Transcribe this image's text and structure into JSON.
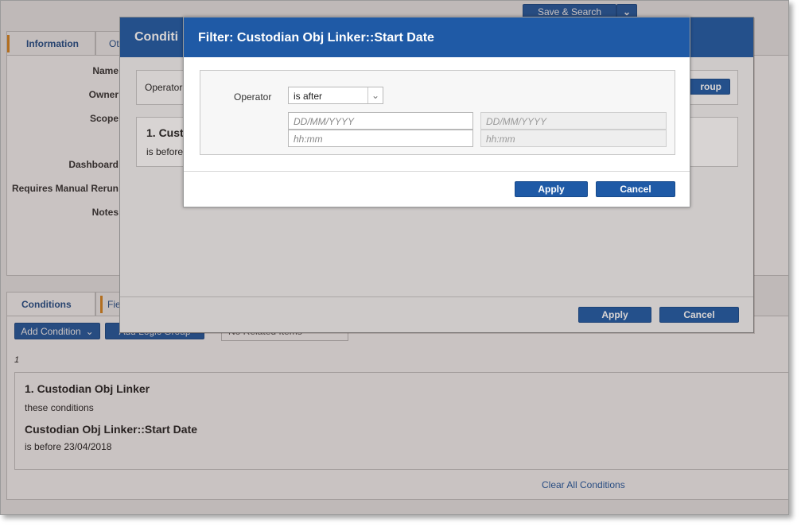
{
  "top": {
    "save_search": "Save & Search"
  },
  "tabs": {
    "information": "Information",
    "other_partial": "Ot"
  },
  "fields": {
    "name": "Name",
    "owner": "Owner",
    "scope": "Scope",
    "dashboard": "Dashboard",
    "requires_manual_rerun": "Requires Manual Rerun",
    "notes": "Notes"
  },
  "bottom_tabs": {
    "conditions": "Conditions",
    "fields_partial": "Fie"
  },
  "toolbar": {
    "add_condition": "Add Condition",
    "add_logic_group_partial": "Add Logic Group",
    "related_items": "No Related Items"
  },
  "list": {
    "index": "1",
    "group_title": "1. Custodian Obj Linker",
    "group_sub": "these conditions",
    "cond_title": "Custodian Obj Linker::Start Date",
    "cond_value": "is before 23/04/2018",
    "clear_all": "Clear All Conditions"
  },
  "dialog1": {
    "title": "Conditi",
    "operator_label": "Operator",
    "group_button_partial": "roup",
    "card_title": "1. Cust",
    "card_sub": "is before",
    "apply": "Apply",
    "cancel": "Cancel"
  },
  "dialog2": {
    "title": "Filter: Custodian Obj Linker::Start Date",
    "operator_label": "Operator",
    "operator_value": "is after",
    "date_placeholder": "DD/MM/YYYY",
    "time_placeholder": "hh:mm",
    "apply": "Apply",
    "cancel": "Cancel"
  },
  "icons": {
    "dropdown": "chevron-down-icon"
  },
  "colors": {
    "primary": "#1f5aa6",
    "accent": "#e08a1e",
    "link": "#1f4e8c"
  }
}
